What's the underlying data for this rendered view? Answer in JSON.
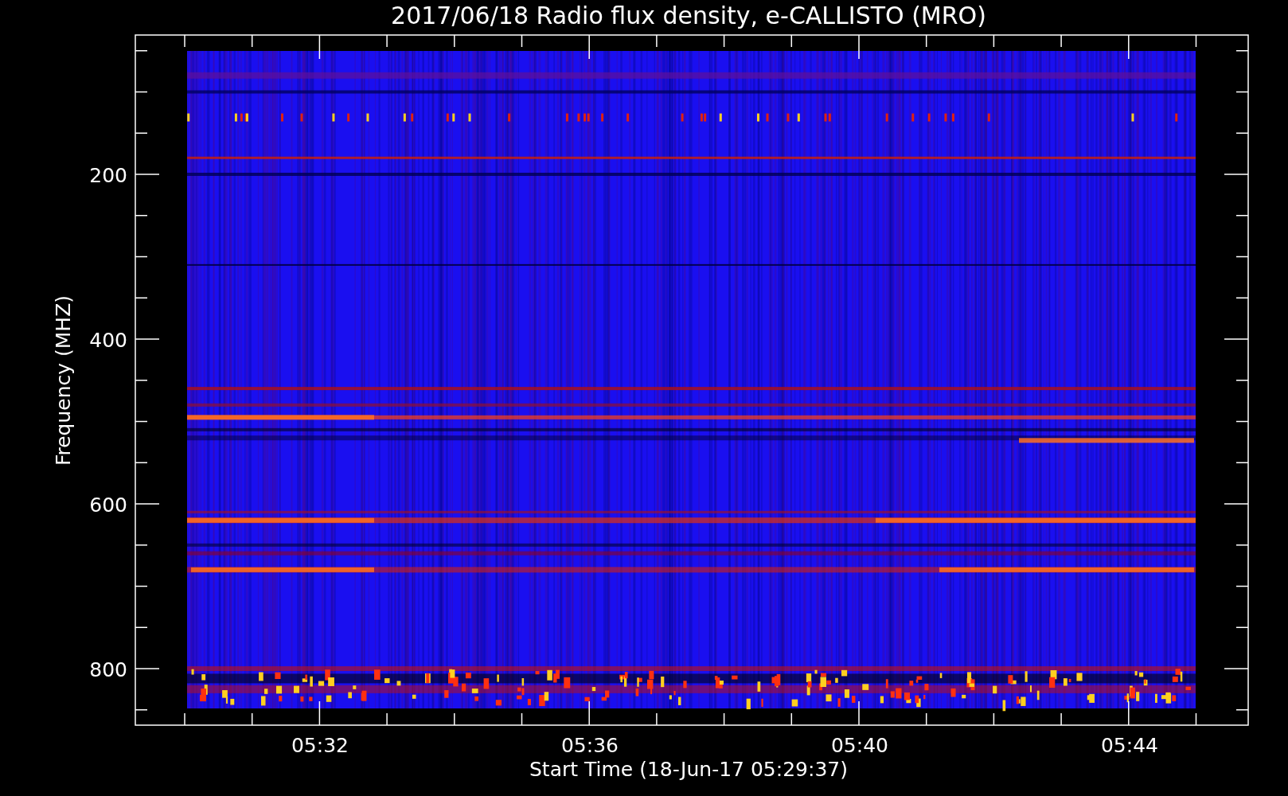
{
  "plot": {
    "title": "2017/06/18  Radio flux density, e-CALLISTO (MRO)",
    "y_axis": {
      "label": "Frequency (MHZ)",
      "ticks": [
        "200",
        "400",
        "600",
        "800"
      ]
    },
    "x_axis": {
      "label": "Start Time (18-Jun-17 05:29:37)",
      "ticks": [
        "05:32",
        "05:36",
        "05:40",
        "05:44"
      ]
    }
  }
}
